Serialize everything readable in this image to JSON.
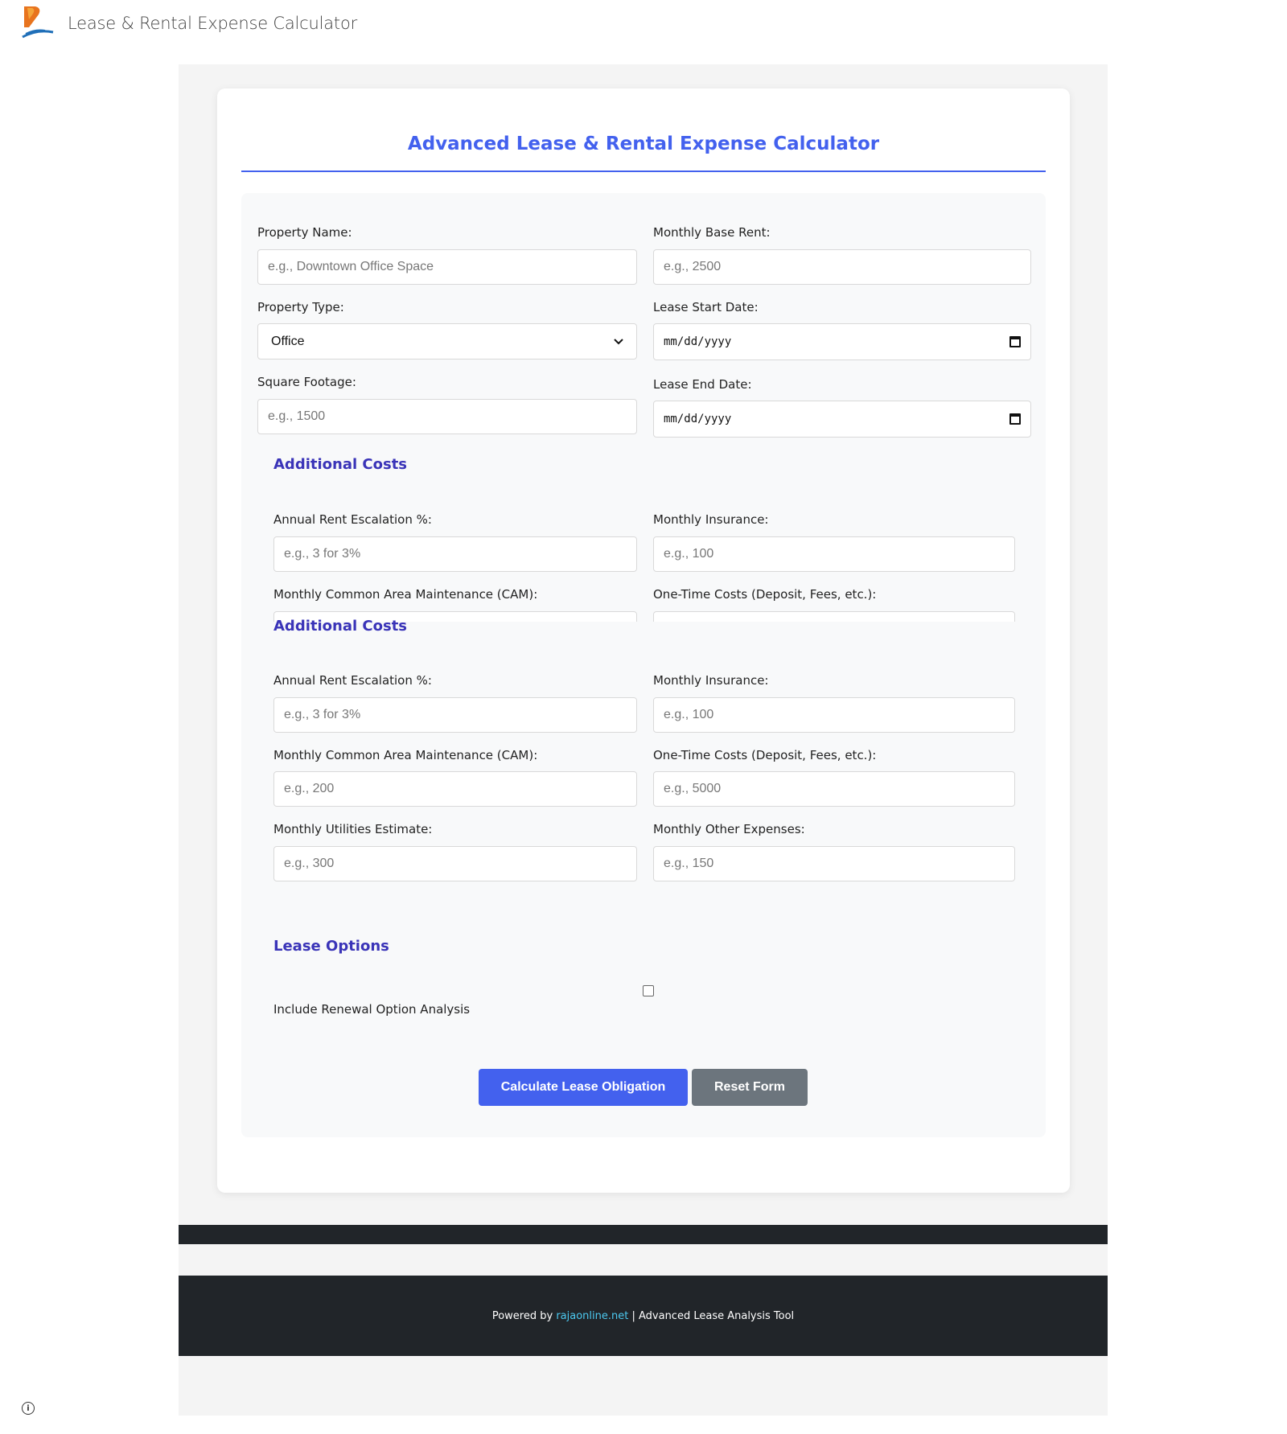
{
  "header": {
    "site_title": "Lease & Rental Expense Calculator"
  },
  "calculator": {
    "title": "Advanced Lease & Rental Expense Calculator",
    "property": {
      "name_label": "Property Name:",
      "name_placeholder": "e.g., Downtown Office Space",
      "rent_label": "Monthly Base Rent:",
      "rent_placeholder": "e.g., 2500",
      "type_label": "Property Type:",
      "type_selected": "Office",
      "start_label": "Lease Start Date:",
      "start_value": "mm/dd/yyyy",
      "sqft_label": "Square Footage:",
      "sqft_placeholder": "e.g., 1500",
      "end_label": "Lease End Date:",
      "end_value": "mm/dd/yyyy"
    },
    "additional_costs": {
      "heading": "Additional Costs",
      "escalation_label": "Annual Rent Escalation %:",
      "escalation_placeholder": "e.g., 3 for 3%",
      "insurance_label": "Monthly Insurance:",
      "insurance_placeholder": "e.g., 100",
      "cam_label": "Monthly Common Area Maintenance (CAM):",
      "cam_placeholder": "e.g., 200",
      "onetime_label": "One-Time Costs (Deposit, Fees, etc.):",
      "onetime_placeholder": "e.g., 5000",
      "utilities_label": "Monthly Utilities Estimate:",
      "utilities_placeholder": "e.g., 300",
      "other_label": "Monthly Other Expenses:",
      "other_placeholder": "e.g., 150"
    },
    "lease_options": {
      "heading": "Lease Options",
      "renewal_label": "Include Renewal Option Analysis"
    },
    "buttons": {
      "calculate": "Calculate Lease Obligation",
      "reset": "Reset Form"
    }
  },
  "footer": {
    "prefix": "Powered by",
    "link": "rajaonline.net",
    "suffix": "| Advanced Lease Analysis Tool"
  },
  "colors": {
    "accent": "#4361ee",
    "section_heading": "#3a34b8",
    "footer_bg": "#212529",
    "link": "#4cc9f0",
    "secondary": "#6c757d"
  }
}
